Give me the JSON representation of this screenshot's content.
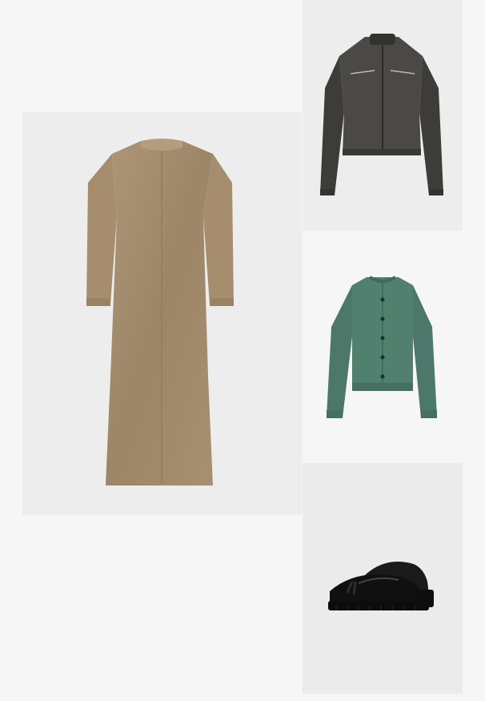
{
  "page": {
    "background": "#f6f6f6"
  },
  "products": [
    {
      "id": "dress",
      "icon": "knit-maxi-dress-image",
      "colors": {
        "main": "#a08a6c",
        "tile": "#ededed"
      }
    },
    {
      "id": "jacket",
      "icon": "leather-biker-jacket-image",
      "colors": {
        "main": "#4a4844",
        "tile": "#ededed"
      }
    },
    {
      "id": "cardigan",
      "icon": "green-knit-cardigan-image",
      "colors": {
        "main": "#4f7a6e",
        "tile": "#f6f6f6"
      }
    },
    {
      "id": "shoes",
      "icon": "black-chunky-loafers-image",
      "colors": {
        "main": "#161616",
        "tile": "#ebebeb"
      }
    }
  ]
}
